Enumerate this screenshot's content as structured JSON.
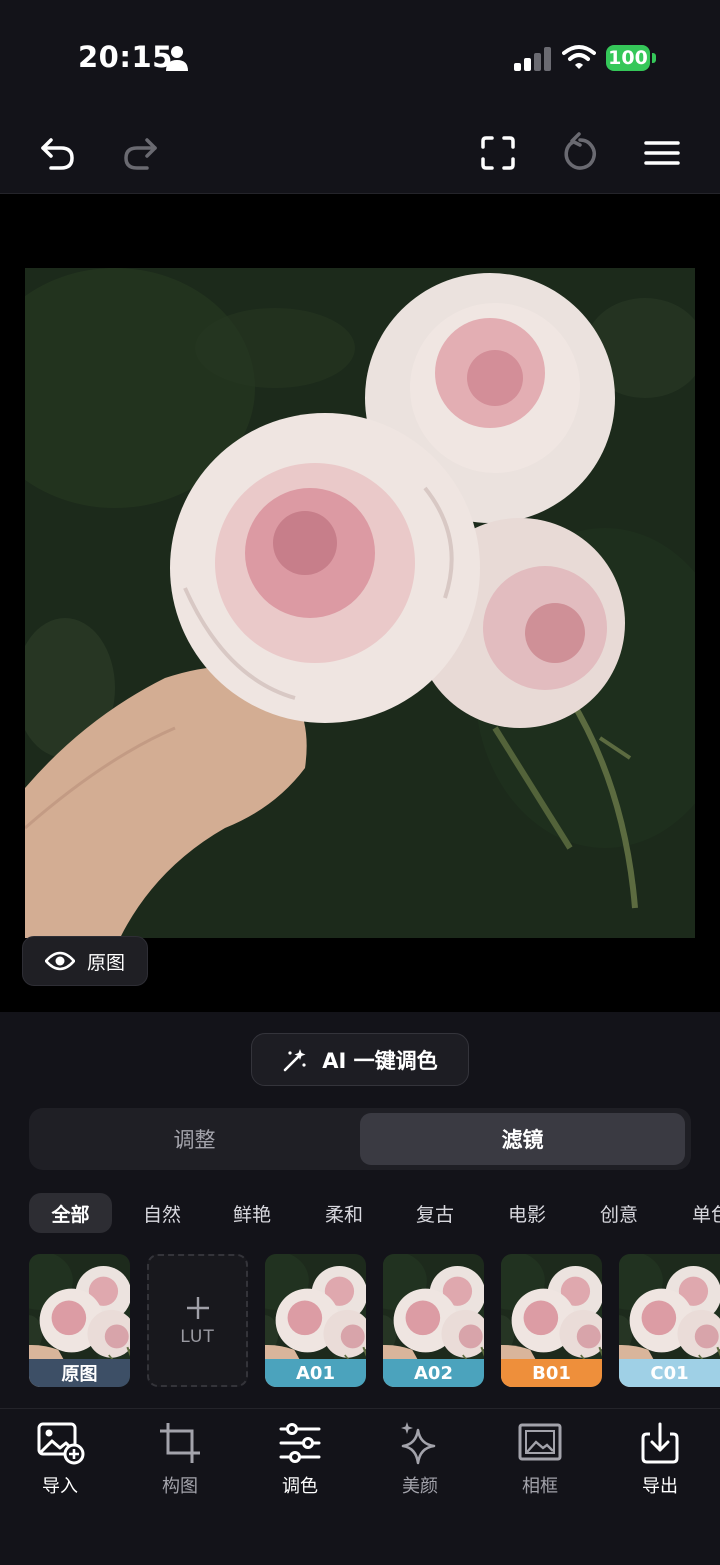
{
  "status_bar": {
    "time": "20:15",
    "battery": "100",
    "icons": [
      "person-icon",
      "signal-icon",
      "wifi-icon",
      "battery-icon"
    ]
  },
  "toolbar": {
    "icons": [
      "undo-icon",
      "redo-icon",
      "fullscreen-icon",
      "reset-icon",
      "menu-icon"
    ]
  },
  "canvas": {
    "compare_label": "原图"
  },
  "ai_button": {
    "label": "AI 一键调色"
  },
  "segments": {
    "adjust": "调整",
    "filter": "滤镜",
    "selected": "filter"
  },
  "categories": [
    {
      "label": "全部",
      "active": true
    },
    {
      "label": "自然"
    },
    {
      "label": "鲜艳"
    },
    {
      "label": "柔和"
    },
    {
      "label": "复古"
    },
    {
      "label": "电影"
    },
    {
      "label": "创意"
    },
    {
      "label": "单色"
    }
  ],
  "filters": {
    "original": "原图",
    "lut": "LUT",
    "items": [
      {
        "label": "A01",
        "color": "#4ba3bd"
      },
      {
        "label": "A02",
        "color": "#4ba3bd"
      },
      {
        "label": "B01",
        "color": "#ee8f3b"
      },
      {
        "label": "C01",
        "color": "#9fd0e6"
      }
    ],
    "original_color": "#3d4f66"
  },
  "bottom_nav": [
    {
      "label": "导入",
      "icon": "import-image-icon",
      "active": true
    },
    {
      "label": "构图",
      "icon": "crop-icon"
    },
    {
      "label": "调色",
      "icon": "sliders-icon",
      "active": true
    },
    {
      "label": "美颜",
      "icon": "sparkle-icon"
    },
    {
      "label": "相框",
      "icon": "frame-icon"
    },
    {
      "label": "导出",
      "icon": "export-icon",
      "active": true
    }
  ],
  "colors": {
    "background": "#131319",
    "accent_green": "#35c759"
  }
}
